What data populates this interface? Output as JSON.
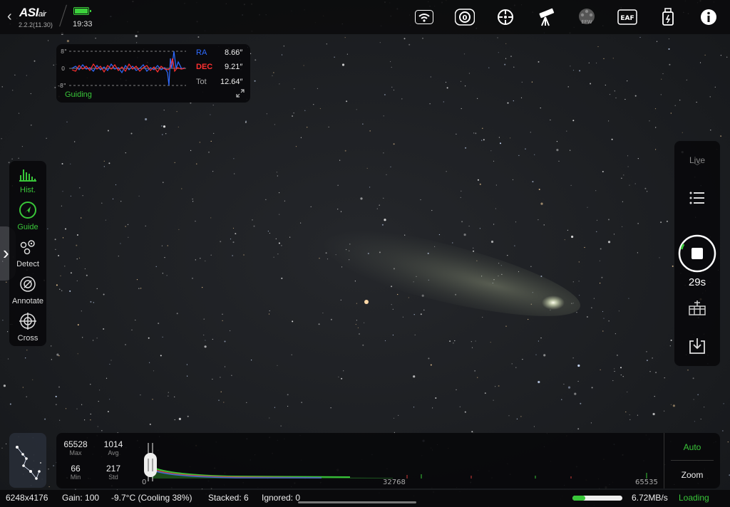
{
  "app": {
    "logo": "ASI",
    "logo_suffix": "air",
    "version": "2.2.2(11.30)",
    "time": "19:33"
  },
  "toolbar_icons": [
    "wifi-icon",
    "filter-wheel-icon",
    "guide-target-icon",
    "telescope-icon",
    "efw-icon",
    "eaf-icon",
    "usb-drive-icon",
    "info-icon"
  ],
  "toolbar_labels": {
    "efw": "EFW",
    "eaf": "EAF"
  },
  "guiding": {
    "label": "Guiding",
    "ymax_label": "8\"",
    "yzero_label": "0",
    "ymin_label": "-8\"",
    "ra_label": "RA",
    "ra_value": "8.66″",
    "dec_label": "DEC",
    "dec_value": "9.21″",
    "tot_label": "Tot",
    "tot_value": "12.64″",
    "ra_color": "#2f6bff",
    "dec_color": "#ff3030"
  },
  "left_tools": [
    {
      "label": "Hist.",
      "active": true,
      "icon": "histogram-icon"
    },
    {
      "label": "Guide",
      "active": true,
      "icon": "guide-icon"
    },
    {
      "label": "Detect",
      "active": false,
      "icon": "detect-icon"
    },
    {
      "label": "Annotate",
      "active": false,
      "icon": "annotate-icon"
    },
    {
      "label": "Cross",
      "active": false,
      "icon": "crosshair-icon"
    }
  ],
  "right_tools": {
    "live_label": "Live",
    "exposure": "29s"
  },
  "histogram": {
    "max_value": "65528",
    "max_label": "Max",
    "avg_value": "1014",
    "avg_label": "Avg",
    "min_value": "66",
    "min_label": "Min",
    "std_value": "217",
    "std_label": "Std",
    "axis_start": "0",
    "axis_mid": "32768",
    "axis_end": "65535",
    "auto_label": "Auto",
    "zoom_label": "Zoom"
  },
  "status_bar": {
    "resolution": "6248x4176",
    "gain": "Gain: 100",
    "temperature": "-9.7°C (Cooling 38%)",
    "stacked": "Stacked: 6",
    "ignored": "Ignored: 0",
    "speed": "6.72MB/s",
    "state": "Loading",
    "progress": 0.25
  },
  "colors": {
    "accent": "#39c639",
    "background": "#1b1d21"
  }
}
